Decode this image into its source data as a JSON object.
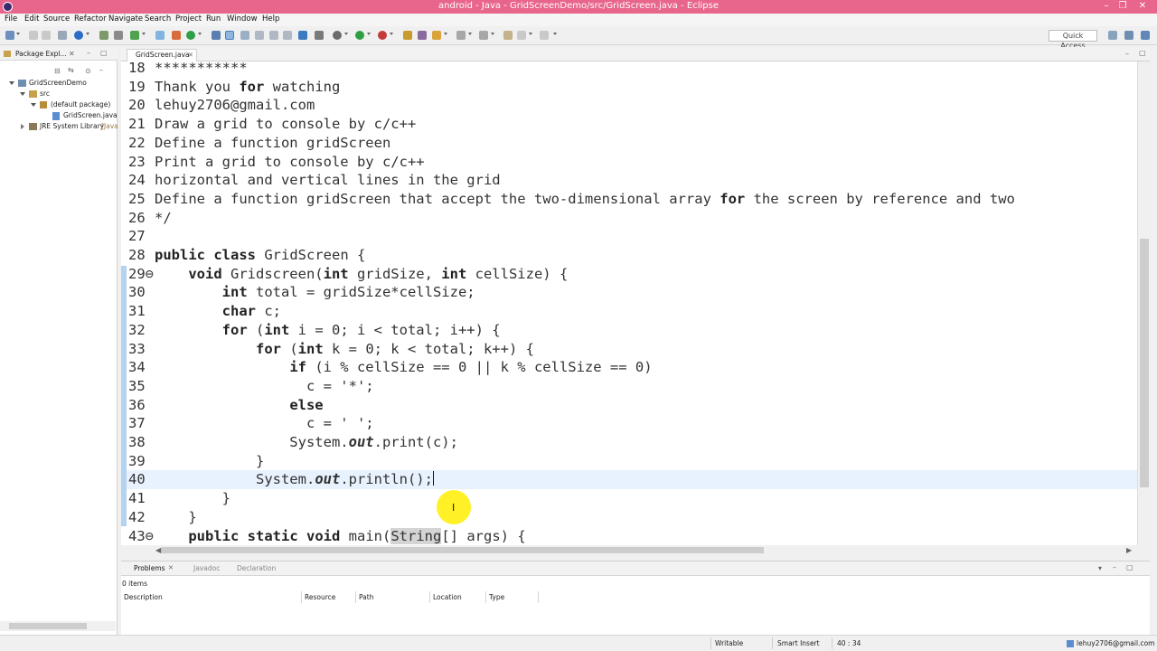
{
  "window": {
    "title": "android - Java - GridScreenDemo/src/GridScreen.java - Eclipse",
    "minimize": "–",
    "maximize": "❐",
    "close": "✕"
  },
  "menu": [
    "File",
    "Edit",
    "Source",
    "Refactor",
    "Navigate",
    "Search",
    "Project",
    "Run",
    "Window",
    "Help"
  ],
  "toolbar": {
    "quick_access": "Quick Access"
  },
  "package_explorer": {
    "tab_label": "Package Expl...",
    "tree": [
      {
        "label": "GridScreenDemo",
        "indent": 0,
        "open": true
      },
      {
        "label": "src",
        "indent": 1,
        "open": true
      },
      {
        "label": "(default package)",
        "indent": 2,
        "open": true
      },
      {
        "label": "GridScreen.java",
        "indent": 3,
        "open": false
      },
      {
        "label": "JRE System Library",
        "suffix": "[Java",
        "indent": 1,
        "open": false
      }
    ]
  },
  "editor": {
    "tab_label": "GridScreen.java",
    "lines": [
      {
        "n": "18",
        "t": "***********"
      },
      {
        "n": "19",
        "t": "Thank you for watching"
      },
      {
        "n": "20",
        "t": "lehuy2706@gmail.com"
      },
      {
        "n": "21",
        "t": "Draw a grid to console by c/c++"
      },
      {
        "n": "22",
        "t": "Define a function gridScreen"
      },
      {
        "n": "23",
        "t": "Print a grid to console by c/c++"
      },
      {
        "n": "24",
        "t": "horizontal and vertical lines in the grid"
      },
      {
        "n": "25",
        "t": "Define a function gridScreen that accept the two-dimensional array for the screen by reference and two"
      },
      {
        "n": "26",
        "t": "*/"
      },
      {
        "n": "27",
        "t": ""
      },
      {
        "n": "28",
        "t": "public class GridScreen {"
      },
      {
        "n": "29⊖",
        "t": "    void Gridscreen(int gridSize, int cellSize) {"
      },
      {
        "n": "30",
        "t": "        int total = gridSize*cellSize;"
      },
      {
        "n": "31",
        "t": "        char c;"
      },
      {
        "n": "32",
        "t": "        for (int i = 0; i < total; i++) {"
      },
      {
        "n": "33",
        "t": "            for (int k = 0; k < total; k++) {"
      },
      {
        "n": "34",
        "t": "                if (i % cellSize == 0 || k % cellSize == 0)"
      },
      {
        "n": "35",
        "t": "                  c = '*';"
      },
      {
        "n": "36",
        "t": "                else"
      },
      {
        "n": "37",
        "t": "                  c = ' ';"
      },
      {
        "n": "38",
        "t": "                System.out.print(c);"
      },
      {
        "n": "39",
        "t": "            }"
      },
      {
        "n": "40",
        "t": "            System.out.println();"
      },
      {
        "n": "41",
        "t": "        }"
      },
      {
        "n": "42",
        "t": "    }"
      },
      {
        "n": "43⊖",
        "t": "    public static void main(String[] args) {"
      }
    ]
  },
  "problems": {
    "tabs": [
      "Problems",
      "Javadoc",
      "Declaration"
    ],
    "count": "0 items",
    "columns": [
      "Description",
      "Resource",
      "Path",
      "Location",
      "Type"
    ]
  },
  "status": {
    "writable": "Writable",
    "insert_mode": "Smart Insert",
    "position": "40 : 34",
    "user": "lehuy2706@gmail.com"
  }
}
